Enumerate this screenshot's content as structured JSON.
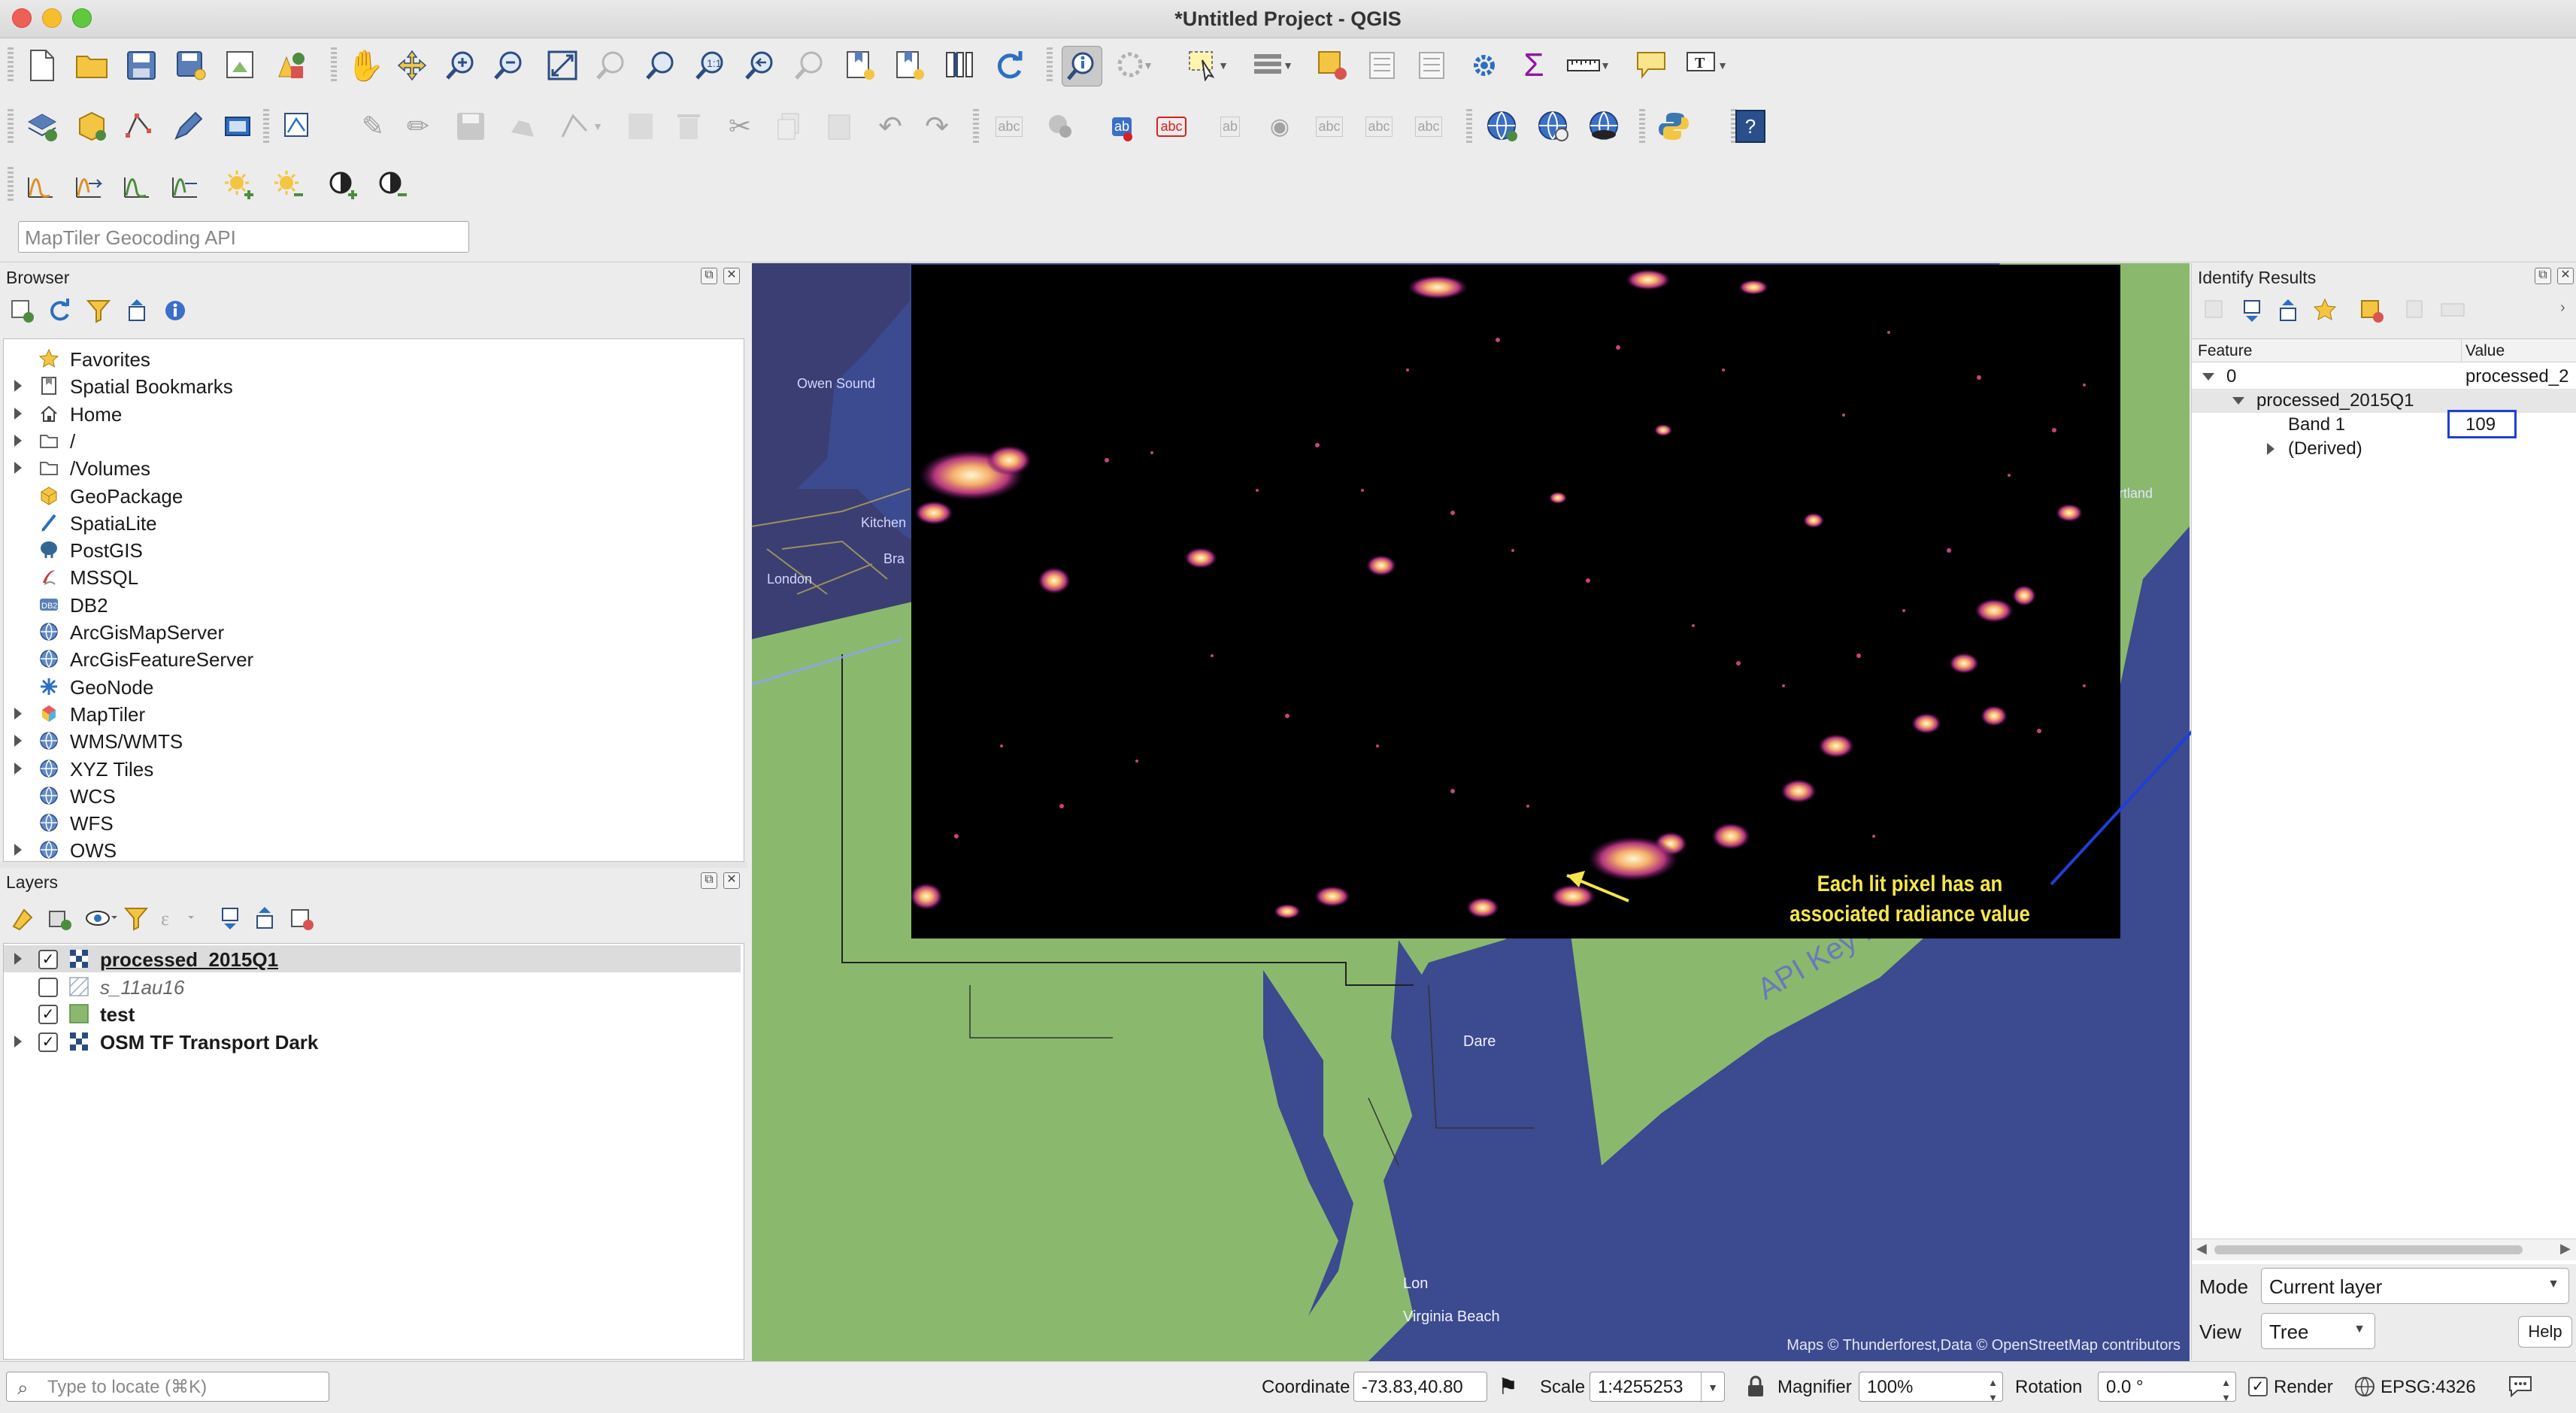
{
  "window": {
    "title": "*Untitled Project - QGIS"
  },
  "toolbars": {
    "file": [
      "new-project-icon",
      "open-project-icon",
      "save-project-icon",
      "save-as-icon",
      "print-layout-icon",
      "style-manager-icon"
    ],
    "nav": [
      "pan-icon",
      "pan-to-selection-icon",
      "zoom-in-icon",
      "zoom-out-icon",
      "zoom-full-icon",
      "zoom-selection-icon",
      "zoom-layer-icon",
      "zoom-native-icon",
      "zoom-last-icon",
      "zoom-next-icon",
      "new-bookmark-icon",
      "show-bookmarks-icon",
      "new-map-view-icon",
      "refresh-icon"
    ],
    "attrs": [
      "identify-icon",
      "action-icon",
      "select-icon",
      "deselect-icon",
      "attribute-table-icon",
      "field-calc-icon",
      "stat-summary-icon",
      "processing-icon",
      "sum-icon",
      "measure-icon",
      "tips-icon",
      "text-annotation-icon"
    ],
    "search_placeholder": "MapTiler Geocoding API"
  },
  "browser": {
    "title": "Browser",
    "items": [
      {
        "label": "Favorites",
        "icon": "star-icon",
        "expandable": false
      },
      {
        "label": "Spatial Bookmarks",
        "icon": "bookmark-icon",
        "expandable": true
      },
      {
        "label": "Home",
        "icon": "home-icon",
        "expandable": true
      },
      {
        "label": "/",
        "icon": "folder-icon",
        "expandable": true
      },
      {
        "label": "/Volumes",
        "icon": "folder-icon",
        "expandable": true
      },
      {
        "label": "GeoPackage",
        "icon": "geopackage-icon",
        "expandable": false
      },
      {
        "label": "SpatiaLite",
        "icon": "spatialite-icon",
        "expandable": false
      },
      {
        "label": "PostGIS",
        "icon": "postgis-icon",
        "expandable": false
      },
      {
        "label": "MSSQL",
        "icon": "mssql-icon",
        "expandable": false
      },
      {
        "label": "DB2",
        "icon": "db2-icon",
        "expandable": false
      },
      {
        "label": "ArcGisMapServer",
        "icon": "globe-icon",
        "expandable": false
      },
      {
        "label": "ArcGisFeatureServer",
        "icon": "globe-icon",
        "expandable": false
      },
      {
        "label": "GeoNode",
        "icon": "geonode-icon",
        "expandable": false
      },
      {
        "label": "MapTiler",
        "icon": "maptiler-icon",
        "expandable": true
      },
      {
        "label": "WMS/WMTS",
        "icon": "globe-icon",
        "expandable": true
      },
      {
        "label": "XYZ Tiles",
        "icon": "globe-icon",
        "expandable": true
      },
      {
        "label": "WCS",
        "icon": "globe-icon",
        "expandable": false
      },
      {
        "label": "WFS",
        "icon": "globe-icon",
        "expandable": false
      },
      {
        "label": "OWS",
        "icon": "globe-icon",
        "expandable": true
      }
    ]
  },
  "layers": {
    "title": "Layers",
    "items": [
      {
        "label": "processed_2015Q1",
        "checked": true,
        "expandable": true,
        "selected": true,
        "bold": true,
        "underline": true
      },
      {
        "label": "s_11au16",
        "checked": false,
        "expandable": false,
        "italic": true
      },
      {
        "label": "test",
        "checked": true,
        "expandable": false,
        "bold": true
      },
      {
        "label": "OSM TF Transport Dark",
        "checked": true,
        "expandable": true,
        "bold": true
      }
    ]
  },
  "map": {
    "labels": {
      "owen_sound": "Owen Sound",
      "kitchener": "Kitchen",
      "brantford": "Bra",
      "london": "London",
      "portland": "rtland",
      "dover": "Dare",
      "virginia_beach": "Virginia Beach",
      "norfolk": "Lon",
      "watermark": "API Key Re"
    },
    "annotation": "Each lit pixel has an associated radiance value",
    "attribution": "Maps © Thunderforest,Data © OpenStreetMap contributors",
    "colors": {
      "water": "#3c4a8f",
      "land": "#8ab96d",
      "raster": "#000000",
      "annotation_text": "#f5e64b",
      "callout_arrow": "#1f3fd6"
    }
  },
  "identify": {
    "title": "Identify Results",
    "columns": [
      "Feature",
      "Value"
    ],
    "rows": [
      {
        "feature": "0",
        "value": "processed_2"
      },
      {
        "feature": "processed_2015Q1",
        "value": ""
      },
      {
        "feature": "Band 1",
        "value": "109"
      },
      {
        "feature": "(Derived)",
        "value": ""
      }
    ],
    "mode_label": "Mode",
    "mode_value": "Current layer",
    "view_label": "View",
    "view_value": "Tree",
    "help_label": "Help"
  },
  "status": {
    "locate_placeholder": "Type to locate (⌘K)",
    "coordinate_label": "Coordinate",
    "coordinate_value": "-73.83,40.80",
    "scale_label": "Scale",
    "scale_value": "1:4255253",
    "magnifier_label": "Magnifier",
    "magnifier_value": "100%",
    "rotation_label": "Rotation",
    "rotation_value": "0.0 °",
    "render_label": "Render",
    "crs_label": "EPSG:4326"
  }
}
